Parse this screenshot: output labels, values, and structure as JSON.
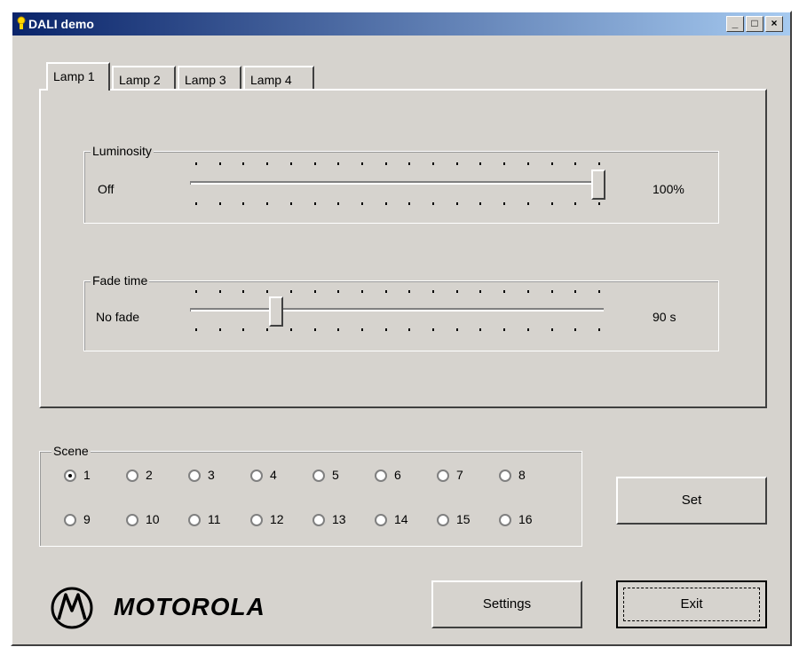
{
  "window": {
    "title": "DALI demo",
    "controls": [
      "_",
      "□",
      "×"
    ]
  },
  "tabs": [
    {
      "label": "Lamp 1",
      "active": true
    },
    {
      "label": "Lamp 2",
      "active": false
    },
    {
      "label": "Lamp 3",
      "active": false
    },
    {
      "label": "Lamp 4",
      "active": false
    }
  ],
  "luminosity": {
    "group_label": "Luminosity",
    "min_label": "Off",
    "value_label": "100%",
    "level": 1.0
  },
  "fade_time": {
    "group_label": "Fade time",
    "min_label": "No fade",
    "value_label": "90 s",
    "level": 0.2
  },
  "scene": {
    "group_label": "Scene",
    "options": [
      "1",
      "2",
      "3",
      "4",
      "5",
      "6",
      "7",
      "8",
      "9",
      "10",
      "11",
      "12",
      "13",
      "14",
      "15",
      "16"
    ],
    "selected": "1"
  },
  "buttons": {
    "set": "Set",
    "settings": "Settings",
    "exit": "Exit"
  },
  "logo": {
    "text": "MOTOROLA"
  }
}
